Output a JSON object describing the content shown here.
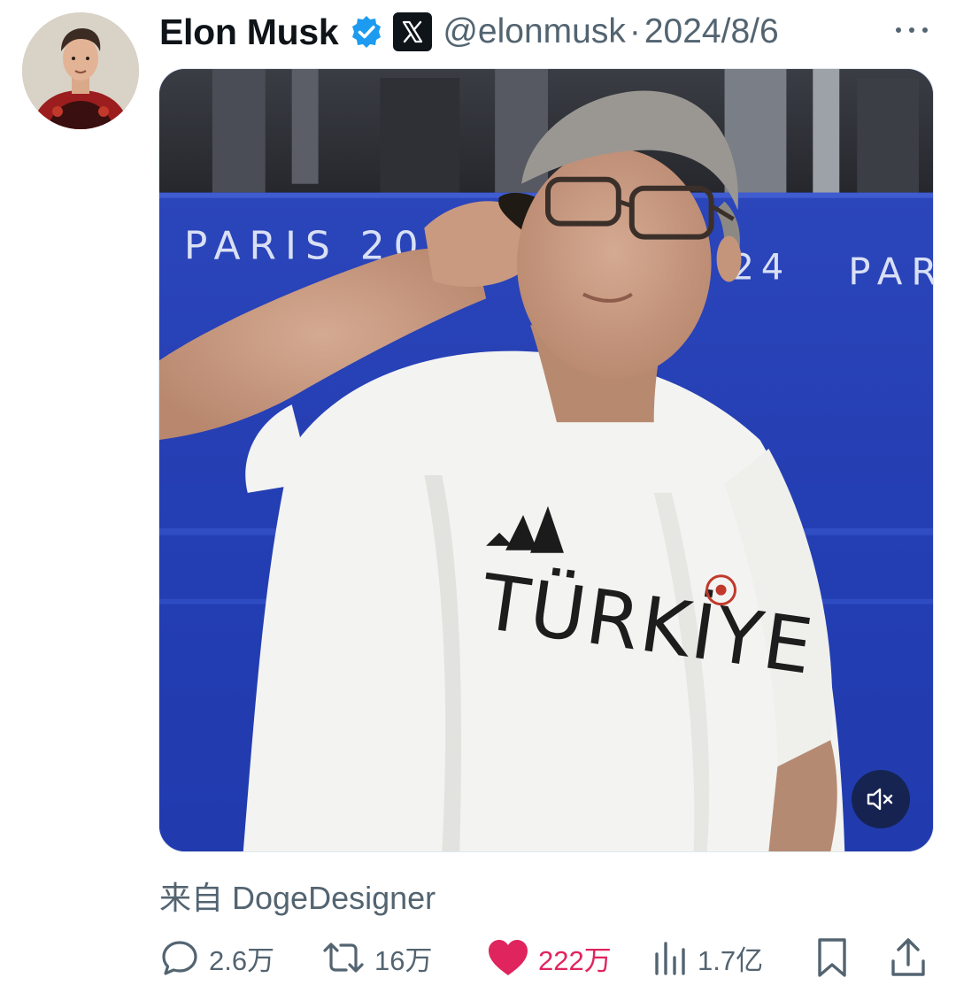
{
  "tweet": {
    "author_name": "Elon Musk",
    "handle": "@elonmusk",
    "separator": "·",
    "date": "2024/8/6",
    "from_label": "来自 DogeDesigner"
  },
  "media": {
    "banner_text_left": "PARIS 20",
    "banner_text_right_num": "24",
    "banner_text_right": "PAR",
    "shirt_text": "TÜRKİYE"
  },
  "actions": {
    "replies": "2.6万",
    "retweets": "16万",
    "likes": "222万",
    "views": "1.7亿"
  },
  "colors": {
    "verified": "#1d9bf0",
    "like": "#e0245e",
    "secondary_text": "#536471",
    "pool_blue": "#2a44b8"
  },
  "icons": {
    "verified": "verified-badge-icon",
    "affiliate": "x-logo-icon",
    "more": "more-dots-icon",
    "mute": "muted-speaker-icon",
    "reply": "reply-bubble-icon",
    "retweet": "retweet-icon",
    "like": "heart-filled-icon",
    "views": "bar-chart-icon",
    "bookmark": "bookmark-icon",
    "share": "share-icon"
  }
}
